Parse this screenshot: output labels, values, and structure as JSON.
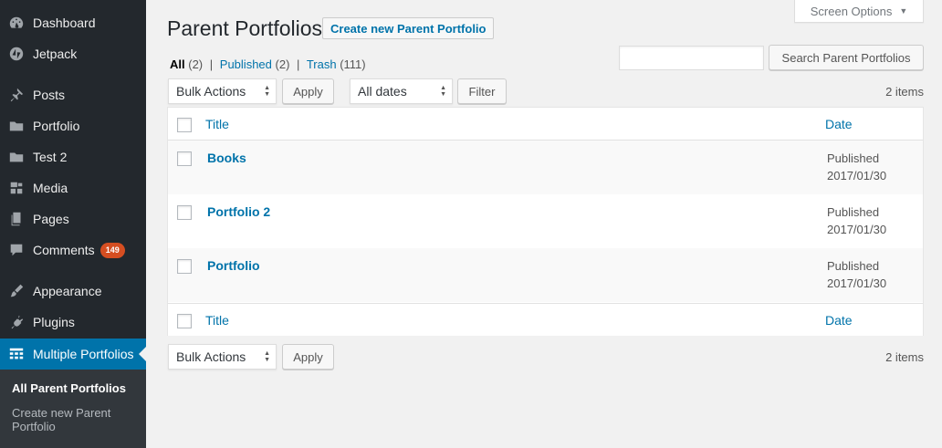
{
  "sidebar": {
    "items": [
      {
        "label": "Dashboard",
        "icon": "dashboard-icon"
      },
      {
        "label": "Jetpack",
        "icon": "jetpack-icon"
      },
      {
        "label": "Posts",
        "icon": "pushpin-icon"
      },
      {
        "label": "Portfolio",
        "icon": "folder-icon"
      },
      {
        "label": "Test 2",
        "icon": "folder-icon"
      },
      {
        "label": "Media",
        "icon": "media-icon"
      },
      {
        "label": "Pages",
        "icon": "pages-icon"
      },
      {
        "label": "Comments",
        "icon": "comment-icon",
        "badge": "149"
      },
      {
        "label": "Appearance",
        "icon": "paintbrush-icon"
      },
      {
        "label": "Plugins",
        "icon": "plugin-icon"
      },
      {
        "label": "Multiple Portfolios",
        "icon": "grid-icon"
      }
    ],
    "submenu": [
      "All Parent Portfolios",
      "Create new Parent Portfolio"
    ]
  },
  "header": {
    "screen_options": "Screen Options",
    "title": "Parent Portfolios",
    "add_new": "Create new Parent Portfolio"
  },
  "views": {
    "all": "All",
    "all_count": "(2)",
    "published": "Published",
    "published_count": "(2)",
    "trash": "Trash",
    "trash_count": "(111)",
    "separator": "|"
  },
  "search": {
    "button": "Search Parent Portfolios",
    "value": ""
  },
  "tablenav": {
    "bulk_actions": "Bulk Actions",
    "apply": "Apply",
    "dates": "All dates",
    "filter": "Filter",
    "items": "2 items"
  },
  "table": {
    "columns": {
      "title": "Title",
      "date": "Date"
    },
    "rows": [
      {
        "title": "Books",
        "status": "Published",
        "date": "2017/01/30"
      },
      {
        "title": "Portfolio 2",
        "status": "Published",
        "date": "2017/01/30"
      },
      {
        "title": "Portfolio",
        "status": "Published",
        "date": "2017/01/30"
      }
    ]
  },
  "colors": {
    "accent": "#0073aa",
    "sidebar_bg": "#23282d",
    "badge": "#d54e21"
  }
}
